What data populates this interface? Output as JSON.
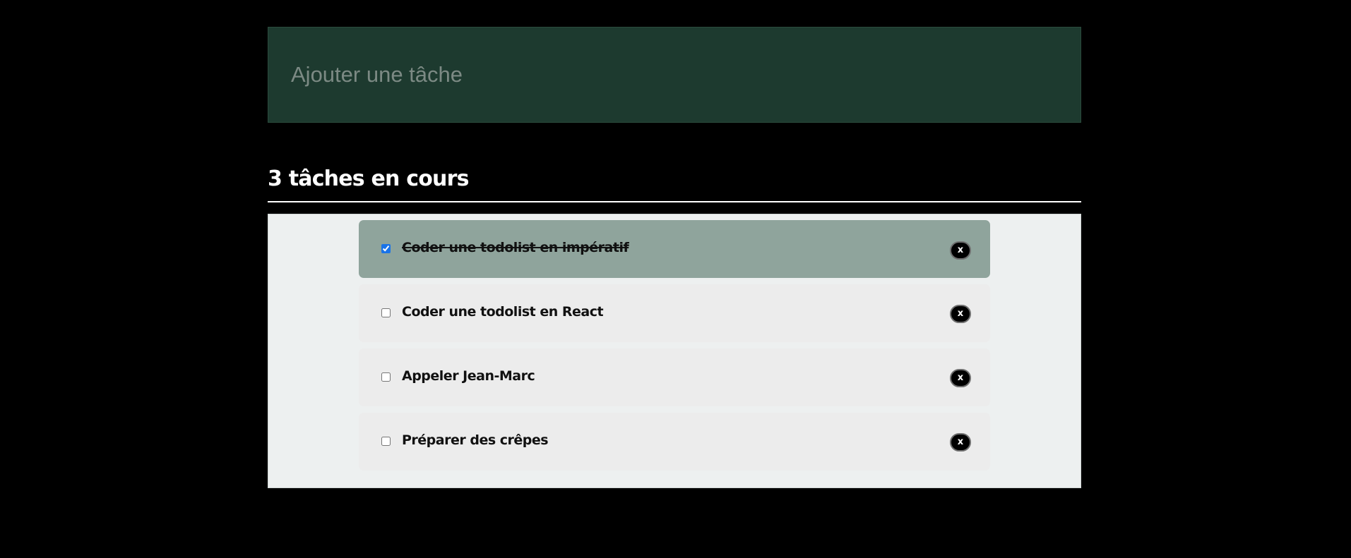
{
  "new_task": {
    "placeholder": "Ajouter une tâche",
    "value": ""
  },
  "summary": {
    "title": "3 tâches en cours"
  },
  "tasks": [
    {
      "label": "Coder une todolist en impératif",
      "done": true,
      "delete_label": "x"
    },
    {
      "label": "Coder une todolist en React",
      "done": false,
      "delete_label": "x"
    },
    {
      "label": "Appeler Jean-Marc",
      "done": false,
      "delete_label": "x"
    },
    {
      "label": "Préparer des crêpes",
      "done": false,
      "delete_label": "x"
    }
  ],
  "colors": {
    "page_background": "#000000",
    "input_background": "#1d3a2f",
    "list_background": "#edf0f0",
    "item_background": "#ececec",
    "done_item_background": "#8fa49c",
    "delete_button": "#000000"
  }
}
